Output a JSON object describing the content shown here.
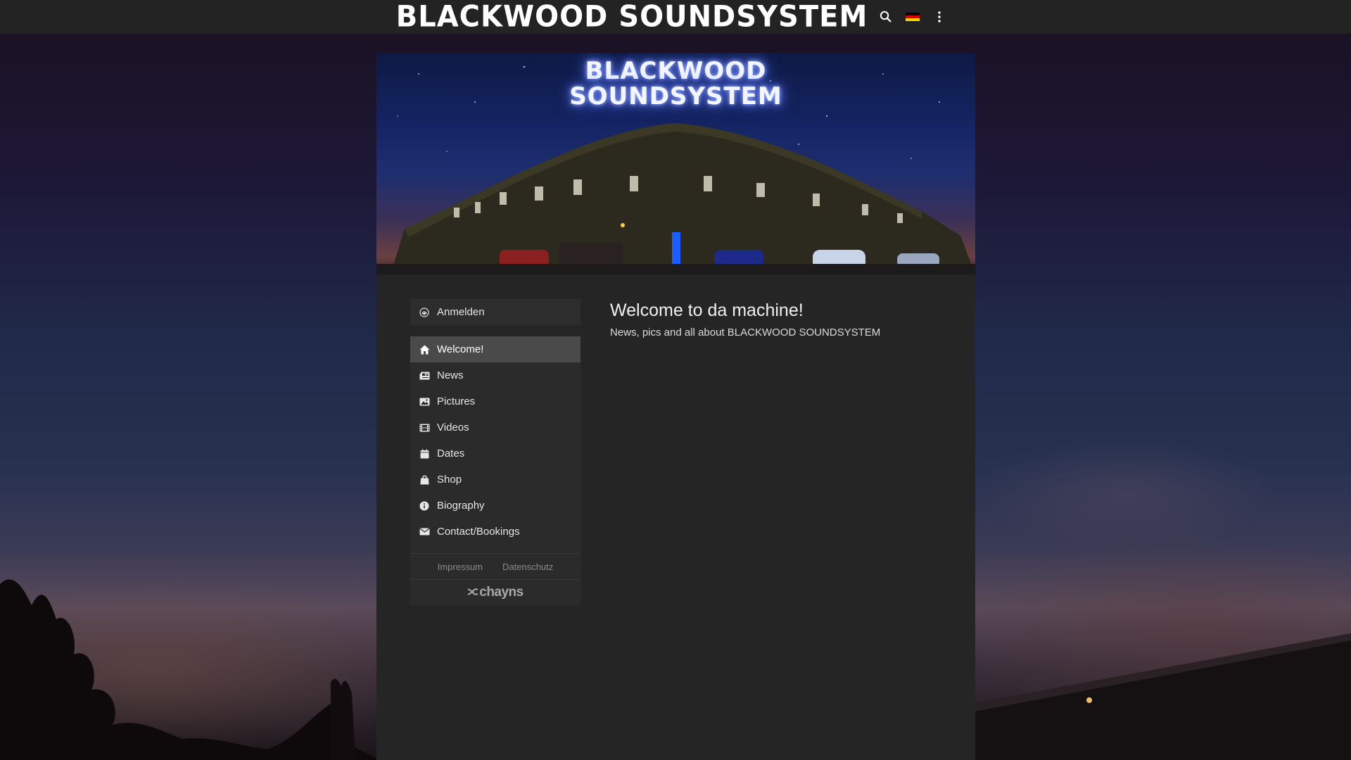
{
  "header": {
    "site_title": "BLACKWOOD SOUNDSYSTEM",
    "search_icon": "search-icon",
    "language_flag": "flag-germany-icon",
    "menu_icon": "more-vertical-icon"
  },
  "banner": {
    "logo_line1": "BLACKWOOD",
    "logo_line2": "SOUNDSYSTEM"
  },
  "sidebar": {
    "login_label": "Anmelden",
    "login_icon": "fingerprint-icon",
    "items": [
      {
        "label": "Welcome!",
        "icon": "home-icon",
        "active": true
      },
      {
        "label": "News",
        "icon": "newspaper-icon",
        "active": false
      },
      {
        "label": "Pictures",
        "icon": "image-icon",
        "active": false
      },
      {
        "label": "Videos",
        "icon": "film-icon",
        "active": false
      },
      {
        "label": "Dates",
        "icon": "calendar-icon",
        "active": false
      },
      {
        "label": "Shop",
        "icon": "shopping-bag-icon",
        "active": false
      },
      {
        "label": "Biography",
        "icon": "info-icon",
        "active": false
      },
      {
        "label": "Contact/Bookings",
        "icon": "envelope-icon",
        "active": false
      }
    ],
    "footer_links": [
      "Impressum",
      "Datenschutz"
    ],
    "brand": "chayns"
  },
  "main": {
    "title": "Welcome to da machine!",
    "subtitle": "News, pics and all about BLACKWOOD SOUNDSYSTEM"
  },
  "colors": {
    "topbar": "#232323",
    "container": "#252525",
    "active_item": "#4a4a4a"
  }
}
